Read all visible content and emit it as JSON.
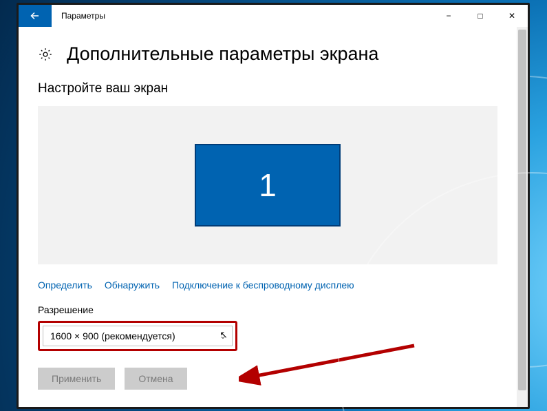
{
  "window": {
    "title": "Параметры",
    "page_title": "Дополнительные параметры экрана"
  },
  "display": {
    "section_heading": "Настройте ваш экран",
    "monitor_number": "1",
    "links": {
      "identify": "Определить",
      "detect": "Обнаружить",
      "wireless": "Подключение к беспроводному дисплею"
    }
  },
  "resolution": {
    "label": "Разрешение",
    "selected": "1600 × 900 (рекомендуется)"
  },
  "buttons": {
    "apply": "Применить",
    "cancel": "Отмена"
  }
}
